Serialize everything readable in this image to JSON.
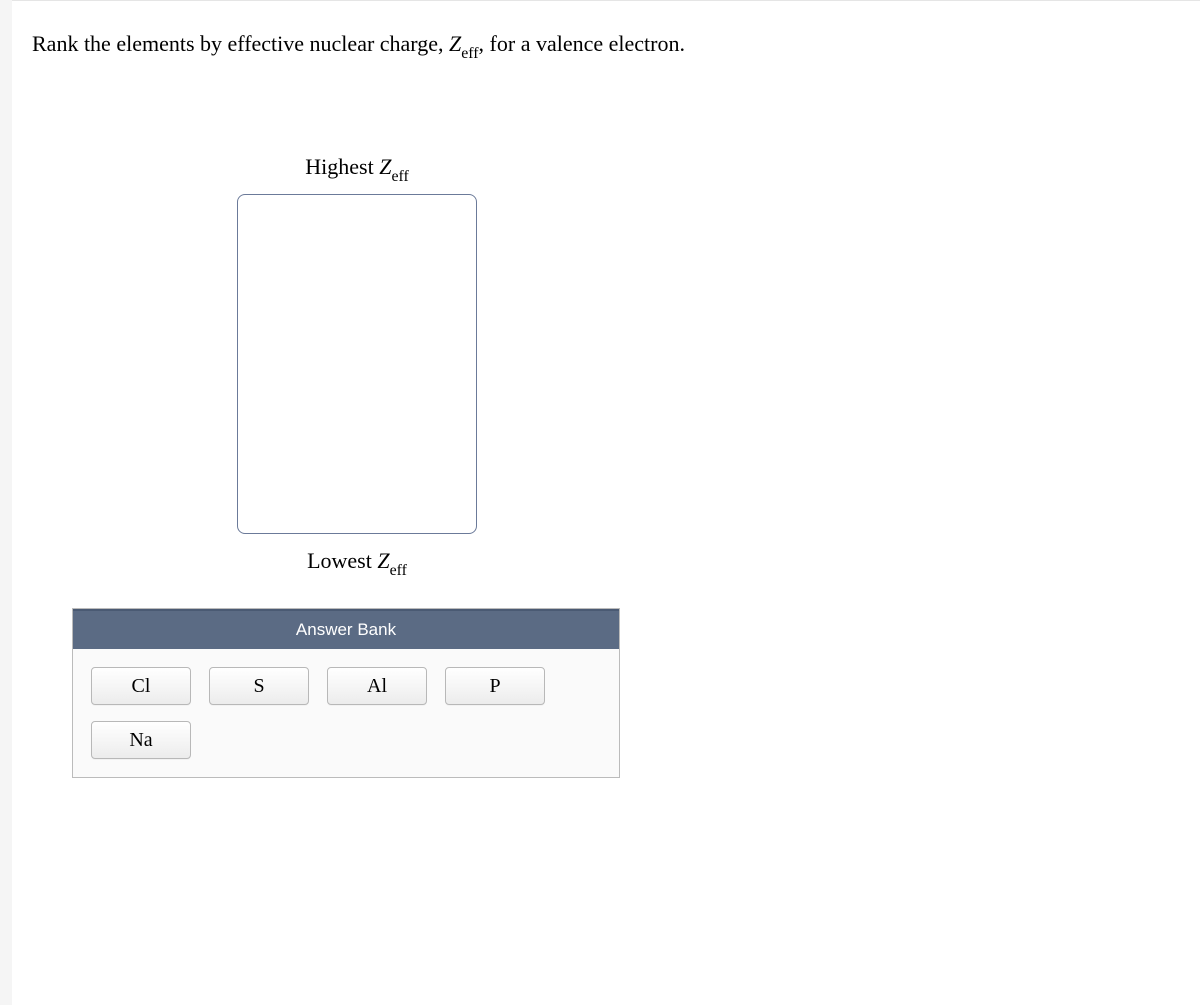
{
  "question": {
    "prefix": "Rank the elements by effective nuclear charge, ",
    "symbol_main": "Z",
    "symbol_sub": "eff",
    "suffix": ", for a valence electron."
  },
  "ranking": {
    "top_label_prefix": "Highest ",
    "top_symbol_main": "Z",
    "top_symbol_sub": "eff",
    "bottom_label_prefix": "Lowest ",
    "bottom_symbol_main": "Z",
    "bottom_symbol_sub": "eff"
  },
  "answer_bank": {
    "header": "Answer Bank",
    "tiles": [
      "Cl",
      "S",
      "Al",
      "P",
      "Na"
    ]
  }
}
